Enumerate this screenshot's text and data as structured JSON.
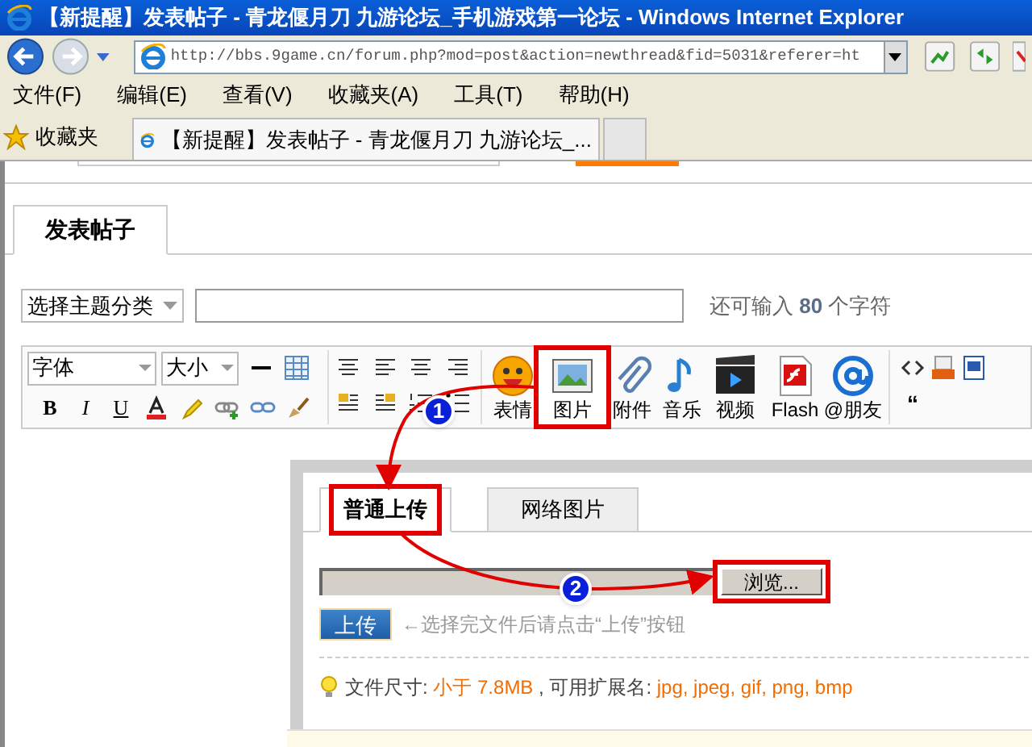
{
  "window": {
    "title": "【新提醒】发表帖子 - 青龙偃月刀 九游论坛_手机游戏第一论坛 - Windows Internet Explorer"
  },
  "address_bar": {
    "url": "http://bbs.9game.cn/forum.php?mod=post&action=newthread&fid=5031&referer=ht"
  },
  "menu": [
    "文件(F)",
    "编辑(E)",
    "查看(V)",
    "收藏夹(A)",
    "工具(T)",
    "帮助(H)"
  ],
  "favorites": {
    "label": "收藏夹"
  },
  "browser_tabs": [
    {
      "title": "【新提醒】发表帖子 - 青龙偃月刀 九游论坛_...",
      "selected": true
    }
  ],
  "page_tabs": [
    {
      "label": "发表帖子",
      "selected": true
    }
  ],
  "category_select": {
    "value": "选择主题分类"
  },
  "subject_hint": {
    "prefix": "还可输入",
    "count": "80",
    "suffix": "个字符"
  },
  "editor_toolbar": {
    "font_select": "字体",
    "size_select": "大小",
    "format_buttons": [
      "B",
      "I",
      "U"
    ],
    "media_buttons": [
      {
        "kind": "emoji",
        "label": "表情",
        "highlighted": false
      },
      {
        "kind": "image",
        "label": "图片",
        "highlighted": true
      },
      {
        "kind": "attachment",
        "label": "附件",
        "highlighted": false
      },
      {
        "kind": "music",
        "label": "音乐",
        "highlighted": false
      },
      {
        "kind": "video",
        "label": "视频",
        "highlighted": false
      },
      {
        "kind": "flash",
        "label": "Flash",
        "highlighted": false
      },
      {
        "kind": "mention",
        "label": "@朋友",
        "highlighted": false
      }
    ],
    "quote_glyph": "“"
  },
  "upload_dialog": {
    "tabs": [
      {
        "label": "普通上传",
        "selected": true,
        "highlighted": true
      },
      {
        "label": "网络图片",
        "selected": false,
        "highlighted": false
      }
    ],
    "browse_button": {
      "label": "浏览...",
      "highlighted": true
    },
    "upload_button": "上传",
    "hint": "←选择完文件后请点击“上传”按钮",
    "file_info": {
      "label": "文件尺寸:",
      "size": "小于 7.8MB",
      "separator": ", 可用扩展名:",
      "extensions": "jpg, jpeg, gif, png, bmp"
    }
  },
  "annotations": [
    {
      "label": "1"
    },
    {
      "label": "2"
    }
  ]
}
